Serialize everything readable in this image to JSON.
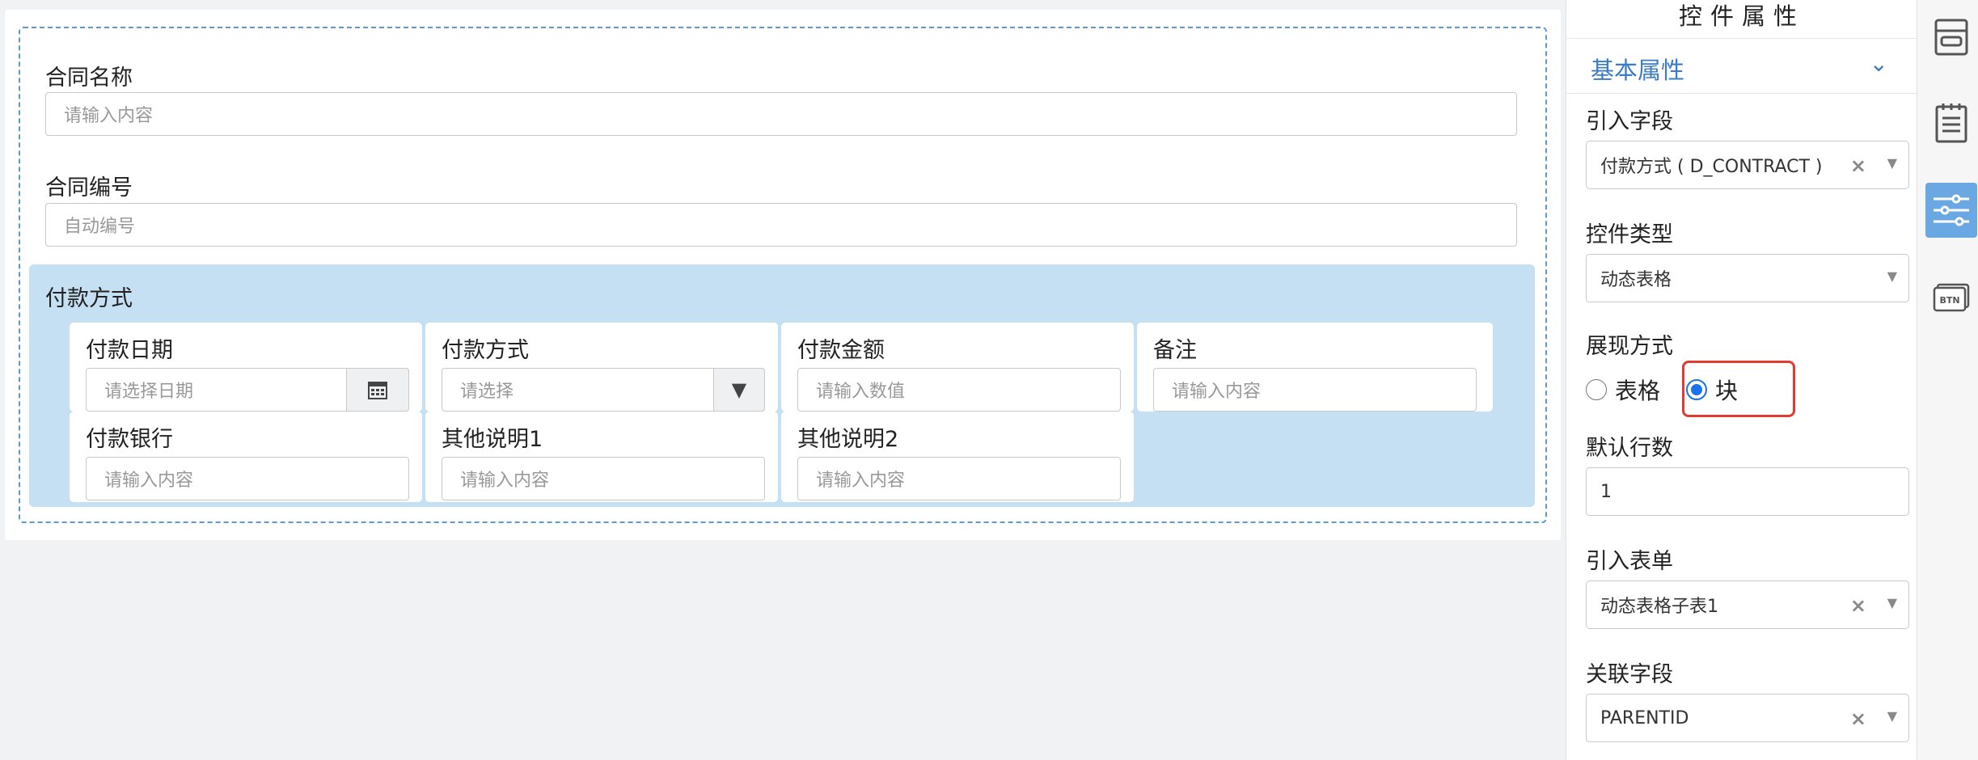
{
  "form": {
    "contract_name": {
      "label": "合同名称",
      "placeholder": "请输入内容"
    },
    "contract_no": {
      "label": "合同编号",
      "placeholder": "自动编号"
    },
    "payment_block": {
      "title": "付款方式",
      "cells": [
        {
          "label": "付款日期",
          "placeholder": "请选择日期",
          "addon": "calendar-icon"
        },
        {
          "label": "付款方式",
          "placeholder": "请选择",
          "addon": "caret-down-icon"
        },
        {
          "label": "付款金额",
          "placeholder": "请输入数值"
        },
        {
          "label": "备注",
          "placeholder": "请输入内容"
        },
        {
          "label": "付款银行",
          "placeholder": "请输入内容"
        },
        {
          "label": "其他说明1",
          "placeholder": "请输入内容"
        },
        {
          "label": "其他说明2",
          "placeholder": "请输入内容"
        }
      ]
    }
  },
  "panel": {
    "title": "控件属性",
    "section": "基本属性",
    "import_field": {
      "label": "引入字段",
      "value": "付款方式 ( D_CONTRACT )"
    },
    "control_type": {
      "label": "控件类型",
      "value": "动态表格"
    },
    "display_mode": {
      "label": "展现方式",
      "options": [
        "表格",
        "块"
      ],
      "selected": "块"
    },
    "default_rows": {
      "label": "默认行数",
      "value": "1"
    },
    "import_form": {
      "label": "引入表单",
      "value": "动态表格子表1"
    },
    "link_field": {
      "label": "关联字段",
      "value": "PARENTID"
    }
  },
  "toolbar": {
    "items": [
      "form-layout-icon",
      "notepad-icon",
      "sliders-icon",
      "btn-icon"
    ],
    "active": "sliders-icon"
  },
  "colors": {
    "accent": "#3a7bc8",
    "block_bg": "#c4e0f2",
    "highlight": "#e03c31",
    "radio": "#1a73e8"
  }
}
